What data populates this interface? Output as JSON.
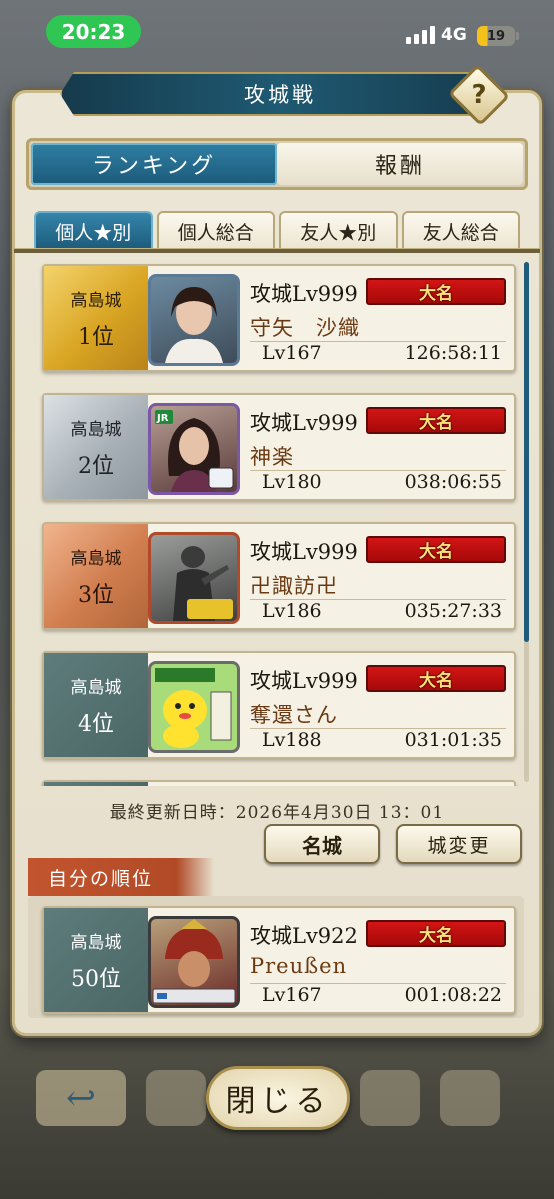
{
  "status_bar": {
    "time": "20:23",
    "network": "4G",
    "battery": "19"
  },
  "dialog": {
    "title": "攻城戦",
    "help": "?"
  },
  "main_tabs": [
    {
      "label": "ランキング",
      "active": true
    },
    {
      "label": "報酬",
      "active": false
    }
  ],
  "sub_tabs": [
    {
      "label": "個人★別",
      "active": true
    },
    {
      "label": "個人総合",
      "active": false
    },
    {
      "label": "友人★別",
      "active": false
    },
    {
      "label": "友人総合",
      "active": false
    }
  ],
  "rankings": [
    {
      "castle": "高島城",
      "rank": "1位",
      "siege_lv": "攻城Lv999",
      "title_badge": "大名",
      "name": "守矢　沙織",
      "lv": "Lv167",
      "time": "126:58:11",
      "tier": "gold",
      "avatar": "portrait-woman-icon"
    },
    {
      "castle": "高島城",
      "rank": "2位",
      "siege_lv": "攻城Lv999",
      "title_badge": "大名",
      "name": "神楽",
      "lv": "Lv180",
      "time": "038:06:55",
      "tier": "silver",
      "avatar": "portrait-woman-jr-icon"
    },
    {
      "castle": "高島城",
      "rank": "3位",
      "siege_lv": "攻城Lv999",
      "title_badge": "大名",
      "name": "卍諏訪卍",
      "lv": "Lv186",
      "time": "035:27:33",
      "tier": "bronze",
      "avatar": "samurai-statue-icon"
    },
    {
      "castle": "高島城",
      "rank": "4位",
      "siege_lv": "攻城Lv999",
      "title_badge": "大名",
      "name": "奪還さん",
      "lv": "Lv188",
      "time": "031:01:35",
      "tier": "teal",
      "avatar": "yellow-mascot-icon"
    }
  ],
  "updated": "最終更新日時：2026年4月30日 13：01",
  "buttons": {
    "meijo": "名城",
    "change_castle": "城変更",
    "close": "閉じる"
  },
  "my_rank": {
    "label": "自分の順位",
    "castle": "高島城",
    "rank": "50位",
    "siege_lv": "攻城Lv922",
    "title_badge": "大名",
    "name": "Preußen",
    "lv": "Lv167",
    "time": "001:08:22",
    "avatar": "armored-warlord-icon"
  },
  "colors": {
    "accent": "#1c5a7b",
    "badge_red": "#c41212",
    "badge_text": "#ffe07a",
    "status_green": "#2fc653"
  }
}
